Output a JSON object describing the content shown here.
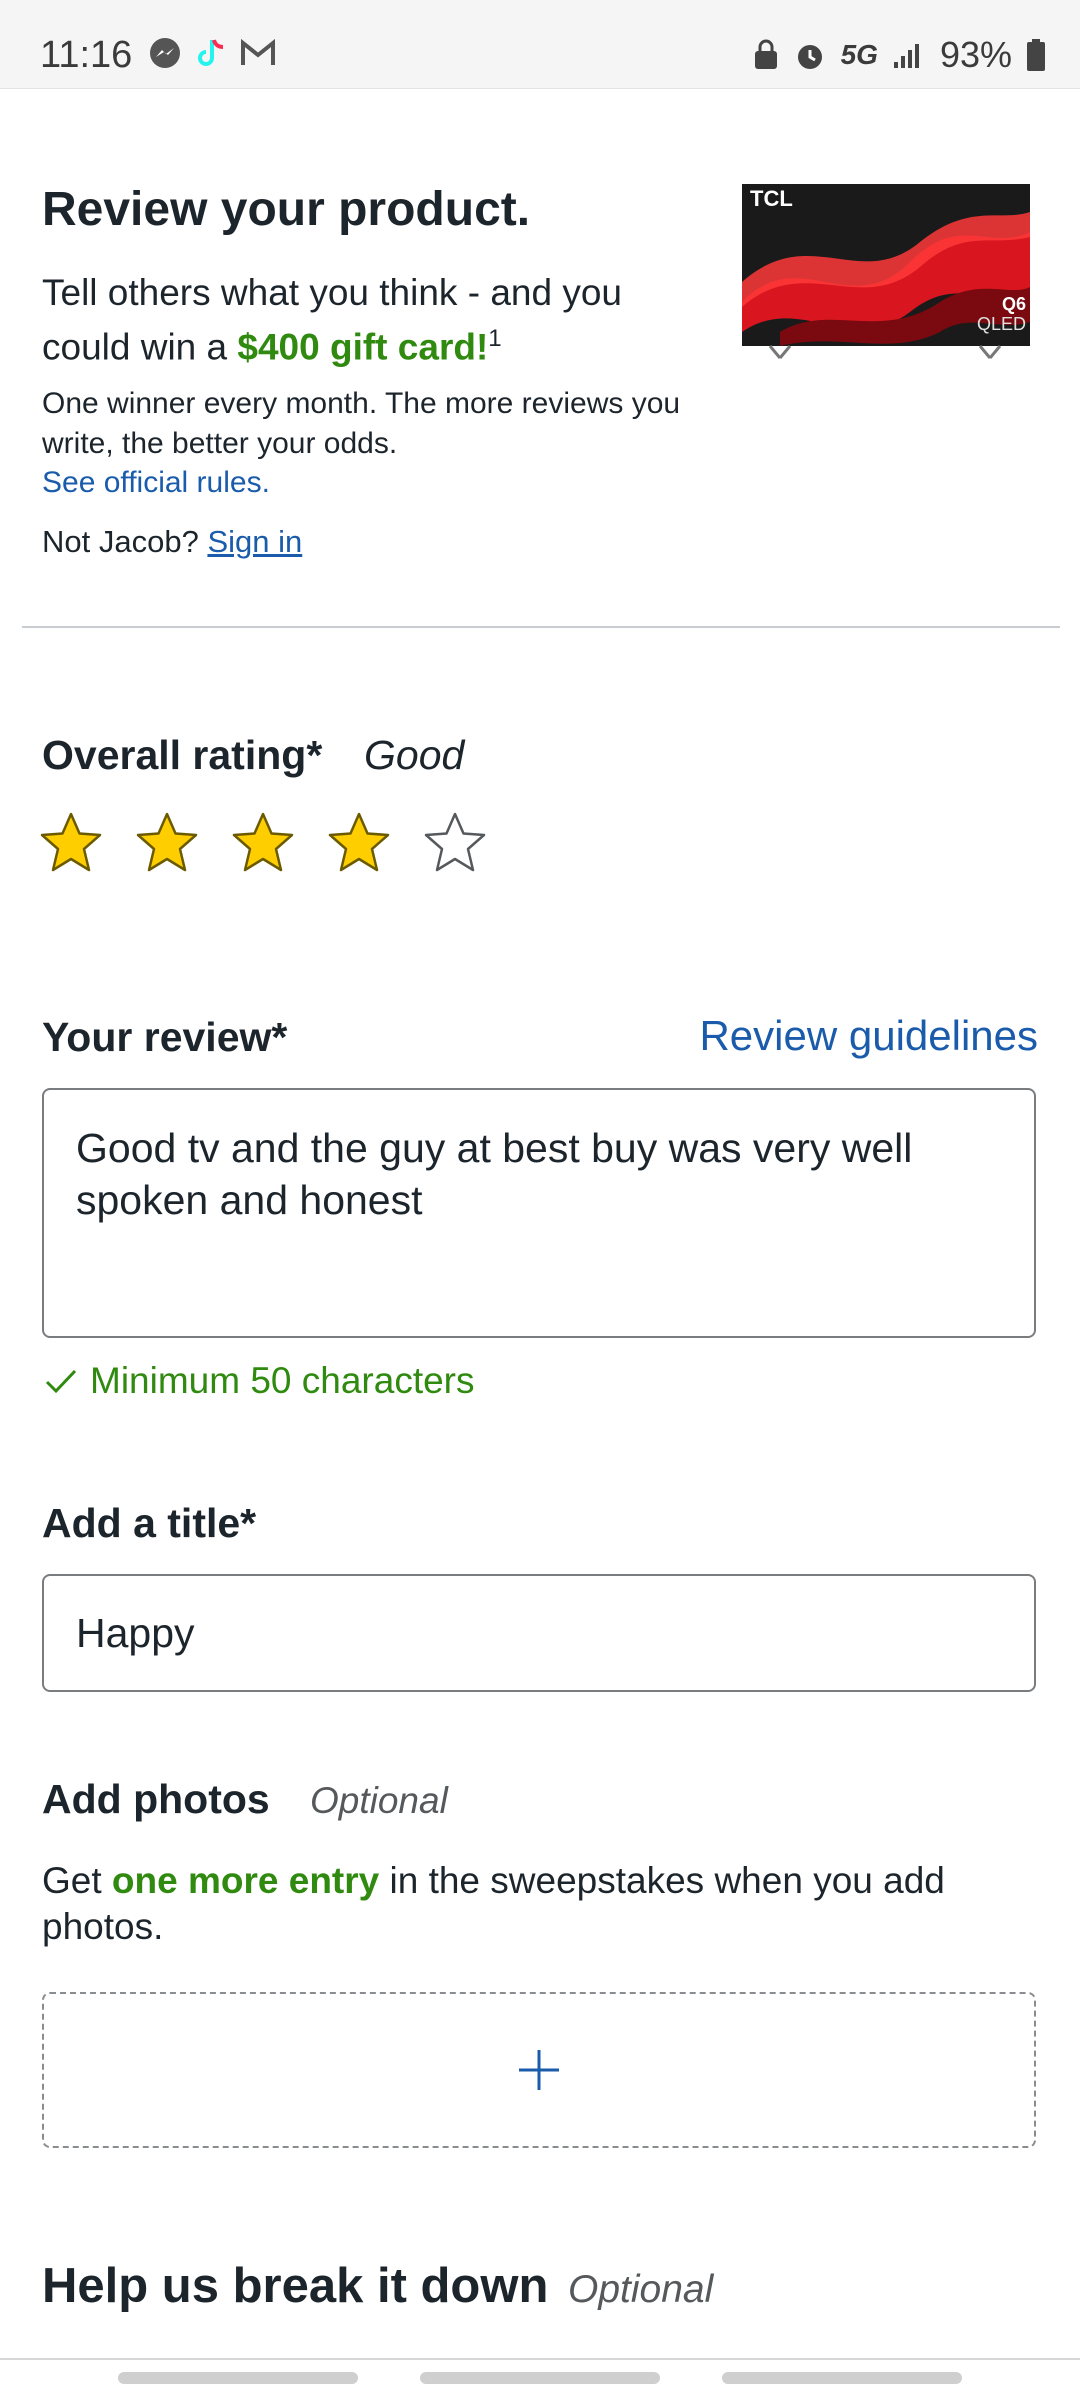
{
  "status_bar": {
    "time": "11:16",
    "network": "5G",
    "battery": "93%",
    "icons": [
      "messenger-icon",
      "tiktok-icon",
      "gmail-icon",
      "lock-icon",
      "alarm-icon",
      "signal-icon",
      "battery-icon"
    ]
  },
  "hero": {
    "title": "Review your product.",
    "subtitle_text": "Tell others what you think - and you could win a ",
    "subtitle_highlight": "$400 gift card!",
    "subtitle_sup": "1",
    "note": "One winner every month. The more reviews you write, the better your odds.",
    "rules_link": "See official rules.",
    "not_user_text": "Not Jacob? ",
    "sign_in": "Sign in",
    "product_brand": "TCL",
    "product_badge_line1": "Q6",
    "product_badge_line2": "QLED"
  },
  "rating": {
    "label": "Overall rating*",
    "value_text": "Good",
    "stars_filled": 4,
    "stars_total": 5
  },
  "review": {
    "label": "Your review*",
    "guidelines_link": "Review guidelines",
    "text": "Good tv and the guy at best buy was very well spoken and honest",
    "validation": "Minimum 50 characters"
  },
  "title_field": {
    "label": "Add a title*",
    "value": "Happy"
  },
  "photos": {
    "label": "Add photos",
    "optional": "Optional",
    "desc_pre": "Get ",
    "desc_highlight": "one more entry",
    "desc_post": " in the sweepstakes when you add photos."
  },
  "breakdown": {
    "label": "Help us break it down",
    "optional": "Optional"
  },
  "colors": {
    "accent_blue": "#1a5bab",
    "success_green": "#2f8a0f",
    "star_yellow": "#ffce00"
  }
}
